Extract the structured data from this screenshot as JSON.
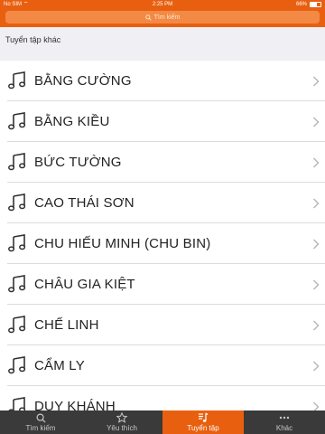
{
  "status_bar": {
    "carrier": "No SIM",
    "time": "2:25 PM",
    "battery_text": "66%",
    "battery_level": 0.66
  },
  "search": {
    "placeholder": "Tìm kiếm",
    "icon": "search-icon"
  },
  "section": {
    "title": "Tuyển tập khác"
  },
  "artists": [
    {
      "label": "BẰNG CƯỜNG",
      "icon": "music-note-icon"
    },
    {
      "label": "BẰNG KIỀU",
      "icon": "music-note-icon"
    },
    {
      "label": "BỨC TƯỜNG",
      "icon": "music-note-icon"
    },
    {
      "label": "CAO THÁI SƠN",
      "icon": "music-note-icon"
    },
    {
      "label": "CHU HIẾU MINH (CHU BIN)",
      "icon": "music-note-icon"
    },
    {
      "label": "CHÂU GIA KIỆT",
      "icon": "music-note-icon"
    },
    {
      "label": "CHẾ LINH",
      "icon": "music-note-icon"
    },
    {
      "label": "CẨM LY",
      "icon": "music-note-icon"
    },
    {
      "label": "DUY KHÁNH",
      "icon": "music-note-icon"
    }
  ],
  "tabbar": {
    "tabs": [
      {
        "label": "Tìm kiếm",
        "icon": "search-icon",
        "active": false
      },
      {
        "label": "Yêu thích",
        "icon": "star-icon",
        "active": false
      },
      {
        "label": "Tuyển tập",
        "icon": "music-list-icon",
        "active": true
      },
      {
        "label": "Khác",
        "icon": "more-icon",
        "active": false
      }
    ]
  },
  "colors": {
    "accent": "#e8600f",
    "tabbar_bg": "#3a3a3a"
  }
}
